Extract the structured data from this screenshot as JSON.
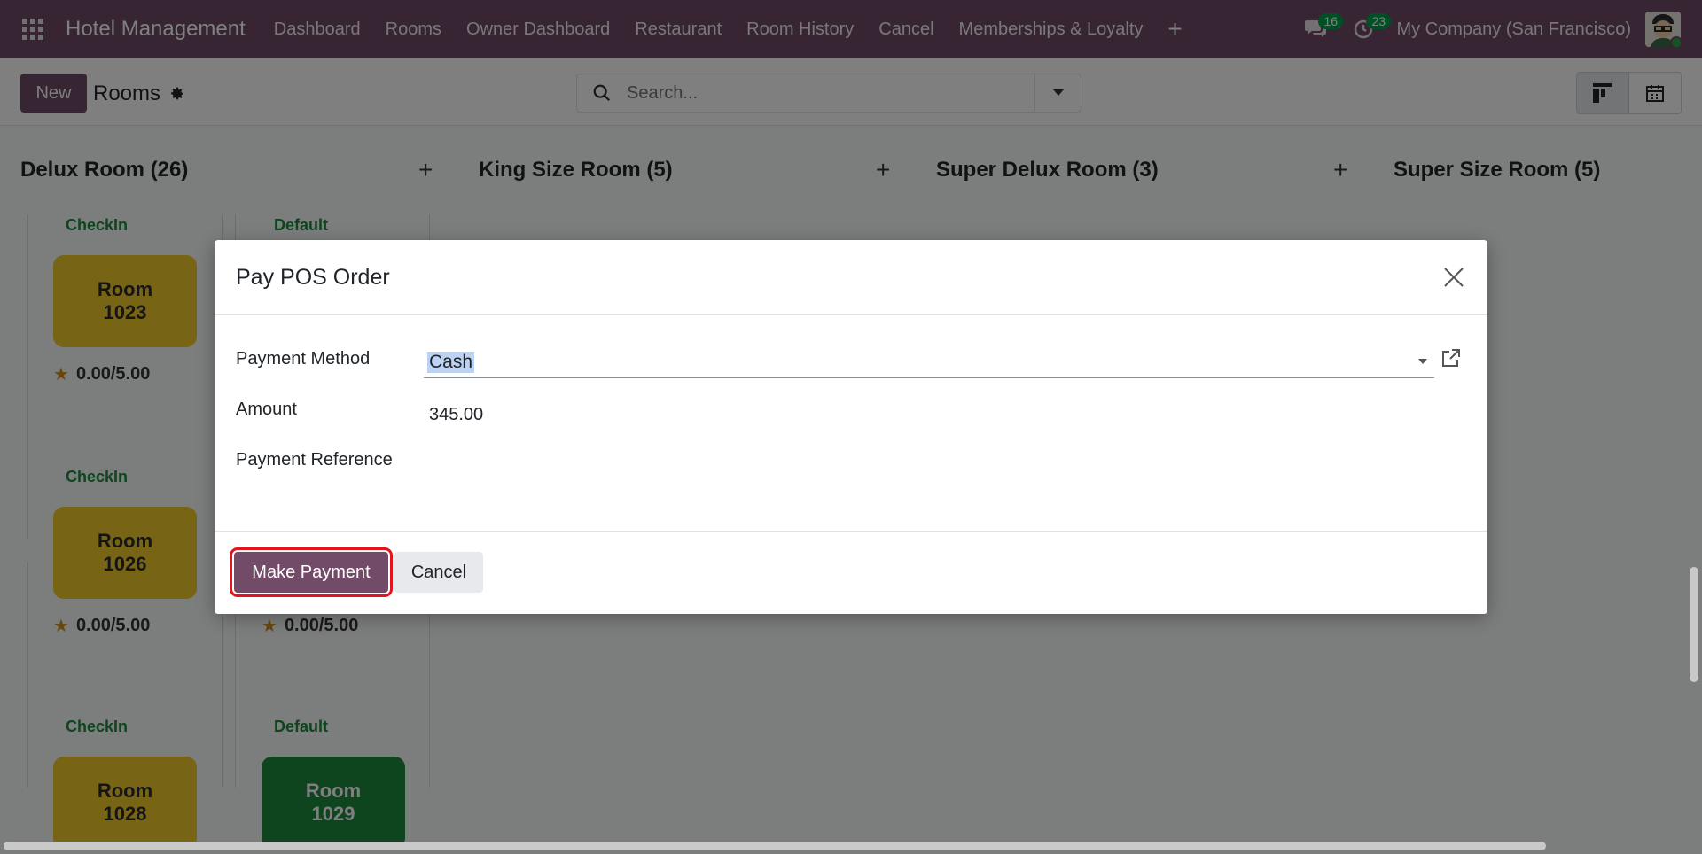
{
  "navbar": {
    "brand": "Hotel Management",
    "menu": [
      "Dashboard",
      "Rooms",
      "Owner Dashboard",
      "Restaurant",
      "Room History",
      "Cancel",
      "Memberships & Loyalty"
    ],
    "plus": "+",
    "messages_count": "16",
    "activities_count": "23",
    "company": "My Company (San Francisco)"
  },
  "control": {
    "new_label": "New",
    "title": "Rooms",
    "search_placeholder": "Search..."
  },
  "kanban": {
    "columns": [
      {
        "title": "Delux Room (26)"
      },
      {
        "title": "King Size Room (5)"
      },
      {
        "title": "Super Delux Room (3)"
      },
      {
        "title": "Super Size Room (5)"
      }
    ],
    "cards": [
      {
        "status": "CheckIn",
        "room_line1": "Room",
        "room_line2": "1023",
        "rating": "0.00/5.00"
      },
      {
        "status": "Default",
        "room_line1": "",
        "room_line2": "",
        "rating": ""
      },
      {
        "status": "CheckIn",
        "room_line1": "Room",
        "room_line2": "1026",
        "rating": "0.00/5.00"
      },
      {
        "status": "",
        "room_line1": "",
        "room_line2": "",
        "rating": "0.00/5.00"
      },
      {
        "status": "CheckIn",
        "room_line1": "Room",
        "room_line2": "1028",
        "rating": ""
      },
      {
        "status": "Default",
        "room_line1": "Room",
        "room_line2": "1029",
        "rating": ""
      }
    ]
  },
  "modal": {
    "title": "Pay POS Order",
    "payment_method_label": "Payment Method",
    "payment_method_value": "Cash",
    "amount_label": "Amount",
    "amount_value": "345.00",
    "reference_label": "Payment Reference",
    "make_payment_label": "Make Payment",
    "cancel_label": "Cancel"
  },
  "colors": {
    "brand": "#714b67",
    "highlight": "#e3141b",
    "checkin_room": "#f1c82a",
    "default_room": "#1d8a3d"
  }
}
